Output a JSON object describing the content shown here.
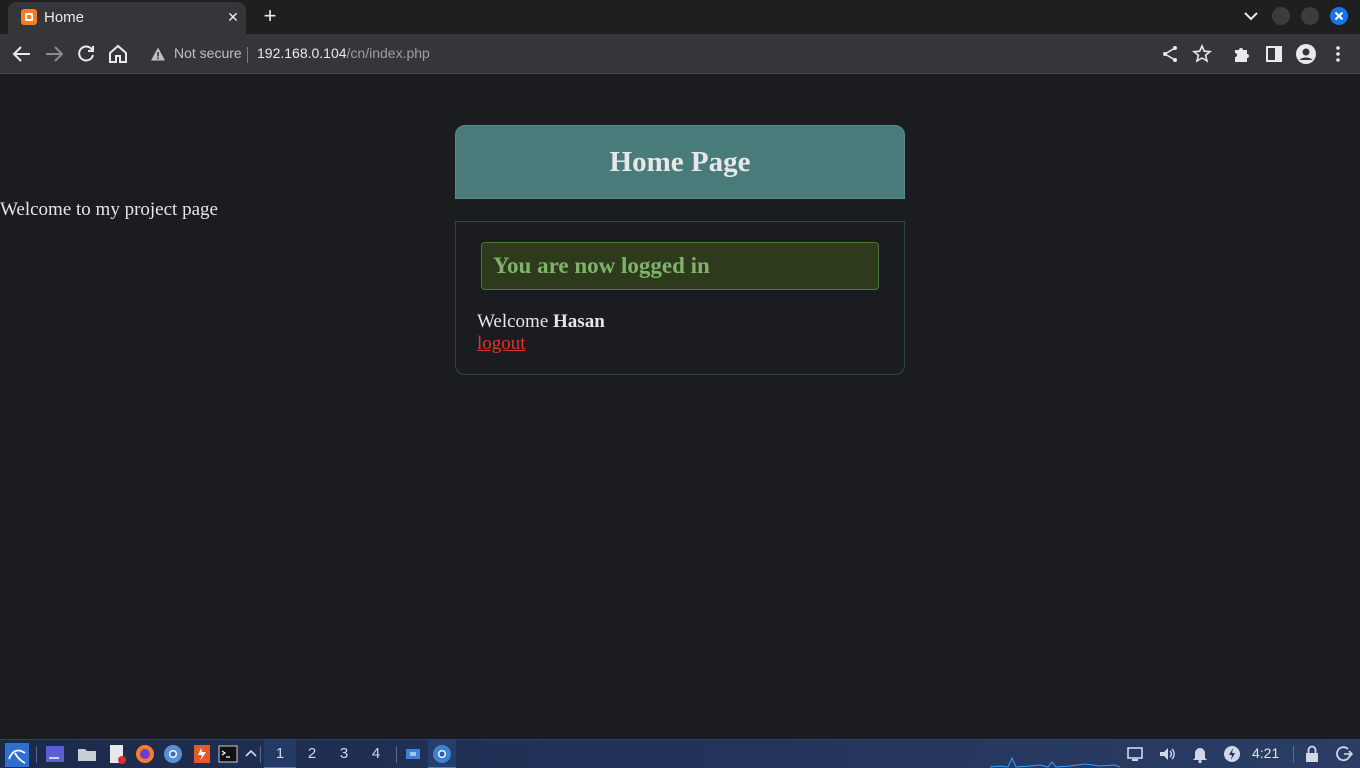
{
  "browser": {
    "tab": {
      "title": "Home",
      "close_glyph": "✕"
    },
    "new_tab_glyph": "+",
    "address": {
      "security_label": "Not secure",
      "url_host": "192.168.0.104",
      "url_path": "/cn/index.php"
    },
    "colors": {
      "tab_active": "#35363a",
      "toolbar": "#35363a",
      "close_button": "#1a73e8"
    }
  },
  "page": {
    "intro_text": "Welcome to my project page",
    "header_title": "Home Page",
    "success_message": "You are now logged in",
    "welcome_prefix": "Welcome",
    "username": "Hasan",
    "logout_label": "logout",
    "colors": {
      "header_bg": "#4a7b7b",
      "success_bg": "#2d3b1c",
      "success_text": "#7fb36a",
      "logout": "#e03434"
    }
  },
  "taskbar": {
    "workspaces": [
      "1",
      "2",
      "3",
      "4"
    ],
    "active_workspace": "1",
    "clock": "4:21"
  }
}
